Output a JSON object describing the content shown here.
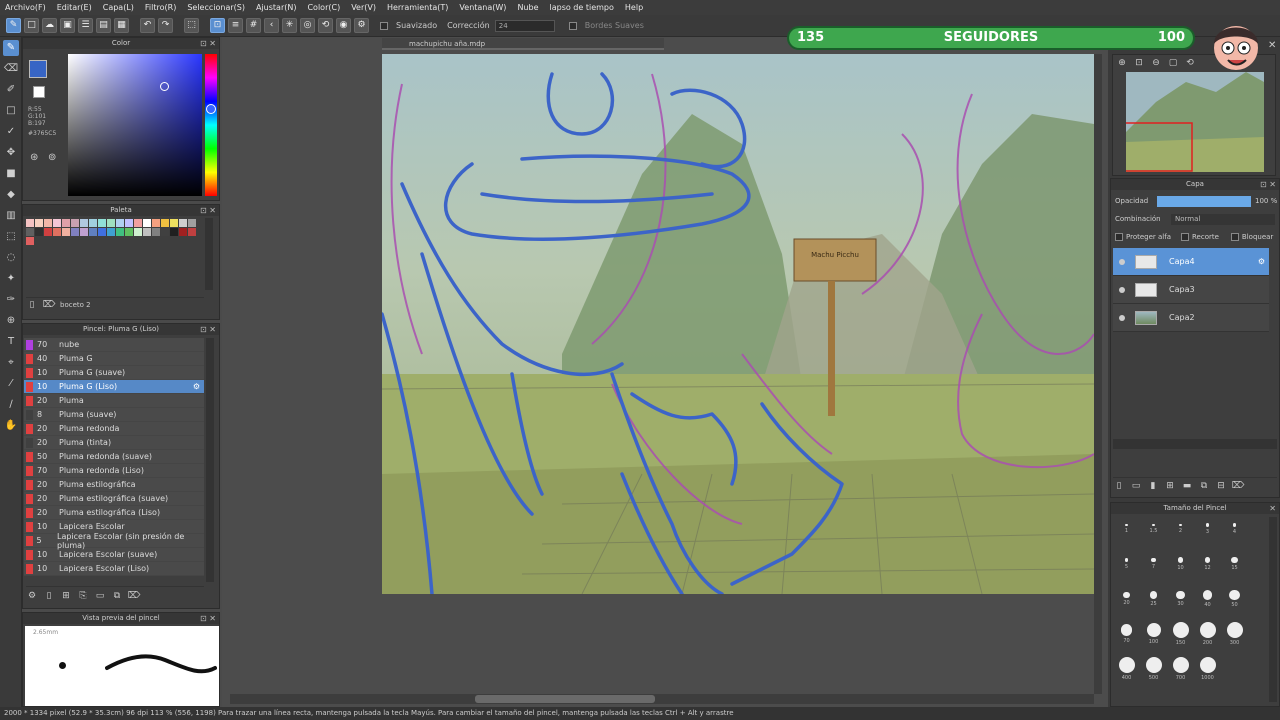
{
  "menu": [
    "Archivo(F)",
    "Editar(E)",
    "Capa(L)",
    "Filtro(R)",
    "Seleccionar(S)",
    "Ajustar(N)",
    "Color(C)",
    "Ver(V)",
    "Herramienta(T)",
    "Ventana(W)",
    "Nube",
    "lapso de tiempo",
    "Help"
  ],
  "toolbar": {
    "suavizado": "Suavizado",
    "correccion": "Corrección",
    "correccion_value": "24",
    "bordes": "Bordes Suaves"
  },
  "document": {
    "tab": "machupichu aña.mdp"
  },
  "color_panel": {
    "title": "Color",
    "r": "R:55",
    "g": "G:101",
    "b": "B:197",
    "hex": "#3765C5",
    "main_color": "#3765c5"
  },
  "palette_panel": {
    "title": "Paleta",
    "name": "boceto 2",
    "colors": [
      "#f4c2c2",
      "#f7d0c0",
      "#f1b6a8",
      "#f4c6d6",
      "#e0a0a8",
      "#c8a0b0",
      "#b0c8e0",
      "#a0d0e0",
      "#90e0d8",
      "#a0e0c0",
      "#b0d0f0",
      "#c0c0ff",
      "#f0a0a0",
      "#ffffff",
      "#f4a080",
      "#f0c040",
      "#f0e060",
      "#d0d0d0",
      "#a0a0a0",
      "#606060",
      "#303030",
      "#d04040",
      "#e07060",
      "#f0b0a0",
      "#8080c0",
      "#c0a0d0",
      "#6080c0",
      "#4070e0",
      "#40a0d0",
      "#40c080",
      "#60c060",
      "#d0f0d0",
      "#c0c0c0",
      "#808080",
      "#404040",
      "#202020",
      "#a02020",
      "#c04040",
      "#e06060"
    ]
  },
  "brush_panel": {
    "title": "Pincel: Pluma G (Liso)",
    "items": [
      {
        "size": "70",
        "name": "nube",
        "color": "#b040e0"
      },
      {
        "size": "40",
        "name": "Pluma G",
        "color": "#e04040"
      },
      {
        "size": "10",
        "name": "Pluma G (suave)",
        "color": "#e04040"
      },
      {
        "size": "10",
        "name": "Pluma G (Liso)",
        "color": "#e04040"
      },
      {
        "size": "20",
        "name": "Pluma",
        "color": "#e04040"
      },
      {
        "size": "8",
        "name": "Pluma (suave)",
        "color": "#404040"
      },
      {
        "size": "20",
        "name": "Pluma redonda",
        "color": "#e04040"
      },
      {
        "size": "20",
        "name": "Pluma (tinta)",
        "color": "#404040"
      },
      {
        "size": "50",
        "name": "Pluma redonda (suave)",
        "color": "#e04040"
      },
      {
        "size": "70",
        "name": "Pluma redonda (Liso)",
        "color": "#e04040"
      },
      {
        "size": "20",
        "name": "Pluma estilográfica",
        "color": "#e04040"
      },
      {
        "size": "20",
        "name": "Pluma estilográfica (suave)",
        "color": "#e04040"
      },
      {
        "size": "20",
        "name": "Pluma estilográfica (Liso)",
        "color": "#e04040"
      },
      {
        "size": "10",
        "name": "Lapicera Escolar",
        "color": "#e04040"
      },
      {
        "size": "5",
        "name": "Lapicera Escolar (sin presión de pluma)",
        "color": "#e04040"
      },
      {
        "size": "10",
        "name": "Lapicera Escolar (suave)",
        "color": "#e04040"
      },
      {
        "size": "10",
        "name": "Lapicera Escolar (Liso)",
        "color": "#e04040"
      }
    ]
  },
  "preview_panel": {
    "title": "Vista previa del pincel",
    "size": "2.65mm"
  },
  "layer_panel": {
    "title": "Capa",
    "opacity_label": "Opacidad",
    "opacity_value": "100 %",
    "opacity_fraction": 1.0,
    "blend_label": "Combinación",
    "blend_value": "Normal",
    "protect_alpha": "Proteger alfa",
    "clip": "Recorte",
    "lock": "Bloquear",
    "layers": [
      "Capa4",
      "Capa3",
      "Capa2"
    ]
  },
  "brush_size_panel": {
    "title": "Tamaño del Pincel",
    "sizes": [
      "1",
      "1.5",
      "2",
      "3",
      "4",
      "5",
      "7",
      "10",
      "12",
      "15",
      "20",
      "25",
      "30",
      "40",
      "50",
      "70",
      "100",
      "150",
      "200",
      "300",
      "400",
      "500",
      "700",
      "1000"
    ]
  },
  "followers": {
    "current": "135",
    "label": "SEGUIDORES",
    "goal": "100",
    "progress_fraction": 1.0
  },
  "status": "2000 * 1334 pixel  (52.9 * 35.3cm)  96 dpi  113 %  (556, 1198)  Para trazar una línea recta, mantenga pulsada la tecla Mayús. Para cambiar el tamaño del pincel, mantenga pulsada las teclas Ctrl + Alt y arrastre",
  "art_sign": "Machu Picchu"
}
